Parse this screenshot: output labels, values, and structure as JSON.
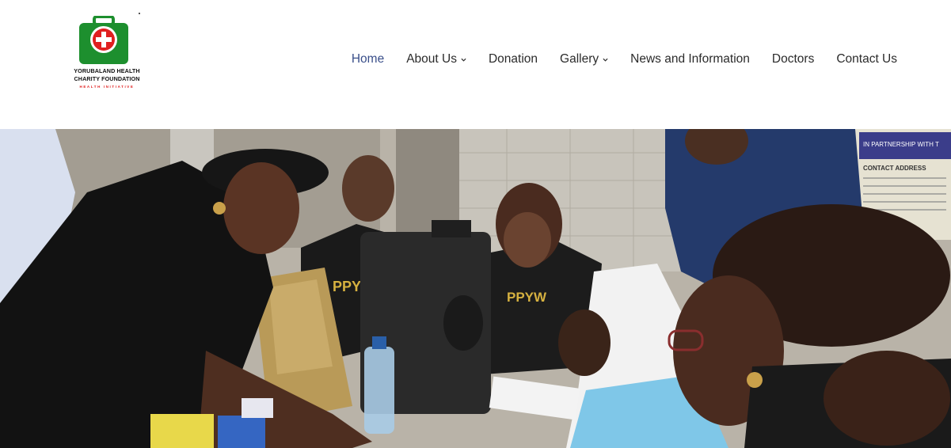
{
  "brand": {
    "line1": "YORUBALAND HEALTH",
    "line2": "CHARITY FOUNDATION",
    "tagline": "HEALTH INITIATIVE",
    "colors": {
      "green": "#1d8f2e",
      "red": "#e02020"
    }
  },
  "nav": {
    "items": [
      {
        "label": "Home",
        "active": true
      },
      {
        "label": "About Us",
        "has_dropdown": true
      },
      {
        "label": "Donation"
      },
      {
        "label": "Gallery",
        "has_dropdown": true
      },
      {
        "label": "News and Information"
      },
      {
        "label": "Doctors"
      },
      {
        "label": "Contact Us"
      }
    ],
    "active_color": "#3a4f8a",
    "text_color": "#2b2b2b"
  },
  "hero": {
    "shirt_text_1": "PPY",
    "shirt_text_2": "PPYW",
    "banner_line_1": "IN PARTNERSHIP WITH T",
    "banner_line_2": "CONTACT ADDRESS"
  }
}
